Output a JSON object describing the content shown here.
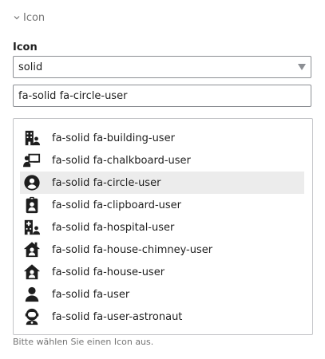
{
  "section": {
    "title": "Icon",
    "icon": "chevron-down-icon"
  },
  "field": {
    "label": "Icon",
    "style_select": {
      "value": "solid"
    },
    "search": {
      "value": "fa-solid fa-circle-user",
      "placeholder": ""
    }
  },
  "icons": [
    {
      "label": "fa-solid fa-building-user",
      "icon": "building-user-icon",
      "selected": false
    },
    {
      "label": "fa-solid fa-chalkboard-user",
      "icon": "chalkboard-user-icon",
      "selected": false
    },
    {
      "label": "fa-solid fa-circle-user",
      "icon": "circle-user-icon",
      "selected": true
    },
    {
      "label": "fa-solid fa-clipboard-user",
      "icon": "clipboard-user-icon",
      "selected": false
    },
    {
      "label": "fa-solid fa-hospital-user",
      "icon": "hospital-user-icon",
      "selected": false
    },
    {
      "label": "fa-solid fa-house-chimney-user",
      "icon": "house-chimney-user-icon",
      "selected": false
    },
    {
      "label": "fa-solid fa-house-user",
      "icon": "house-user-icon",
      "selected": false
    },
    {
      "label": "fa-solid fa-user",
      "icon": "user-icon",
      "selected": false
    },
    {
      "label": "fa-solid fa-user-astronaut",
      "icon": "user-astronaut-icon",
      "selected": false
    }
  ],
  "help_text": "Bitte wählen Sie einen Icon aus.",
  "colors": {
    "text": "#1e1e1e",
    "muted": "#757575",
    "border": "#8c8f94",
    "selected_bg": "#ececec"
  }
}
